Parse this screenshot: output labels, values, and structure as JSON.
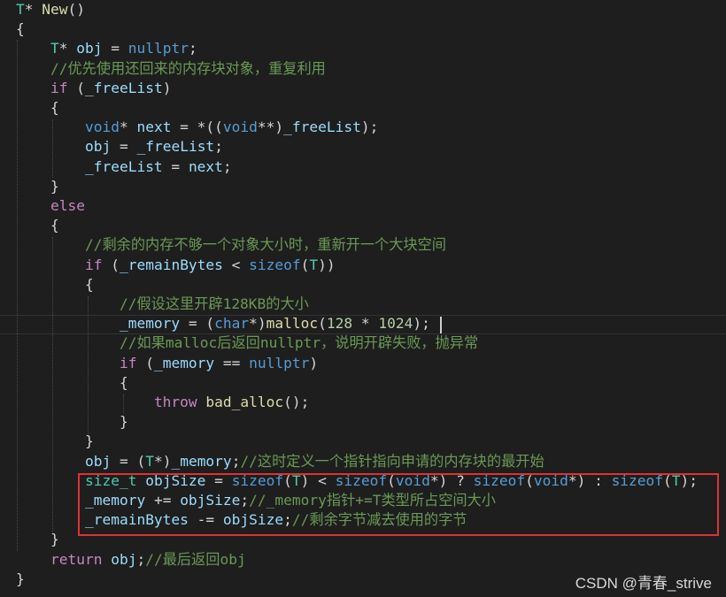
{
  "editor": {
    "language": "C++",
    "theme_colors": {
      "background": "#1e1e1e",
      "keyword": "#569cd6",
      "control": "#c586c0",
      "comment": "#6a9955",
      "function": "#dcdcaa",
      "type": "#4ec9b0",
      "variable": "#9cdcfe",
      "number": "#b5cea8",
      "text": "#d4d4d4",
      "highlight_box": "#e03131"
    },
    "lines": [
      [
        [
          "ty",
          "T"
        ],
        [
          "pl",
          "* "
        ],
        [
          "fn",
          "New"
        ],
        [
          "pl",
          "()"
        ]
      ],
      [
        [
          "pl",
          "{"
        ]
      ],
      [
        [
          "pl",
          "    "
        ],
        [
          "ty",
          "T"
        ],
        [
          "pl",
          "* "
        ],
        [
          "var",
          "obj"
        ],
        [
          "pl",
          " = "
        ],
        [
          "kw",
          "nullptr"
        ],
        [
          "pl",
          ";"
        ]
      ],
      [
        [
          "pl",
          "    "
        ],
        [
          "cm",
          "//优先使用还回来的内存块对象，重复利用"
        ]
      ],
      [
        [
          "pl",
          "    "
        ],
        [
          "ctl",
          "if"
        ],
        [
          "pl",
          " ("
        ],
        [
          "var",
          "_freeList"
        ],
        [
          "pl",
          ")"
        ]
      ],
      [
        [
          "pl",
          "    {"
        ]
      ],
      [
        [
          "pl",
          "        "
        ],
        [
          "kw",
          "void"
        ],
        [
          "pl",
          "* "
        ],
        [
          "var",
          "next"
        ],
        [
          "pl",
          " = *(("
        ],
        [
          "kw",
          "void"
        ],
        [
          "pl",
          "**)"
        ],
        [
          "var",
          "_freeList"
        ],
        [
          "pl",
          ");"
        ]
      ],
      [
        [
          "pl",
          "        "
        ],
        [
          "var",
          "obj"
        ],
        [
          "pl",
          " = "
        ],
        [
          "var",
          "_freeList"
        ],
        [
          "pl",
          ";"
        ]
      ],
      [
        [
          "pl",
          "        "
        ],
        [
          "var",
          "_freeList"
        ],
        [
          "pl",
          " = "
        ],
        [
          "var",
          "next"
        ],
        [
          "pl",
          ";"
        ]
      ],
      [
        [
          "pl",
          "    }"
        ]
      ],
      [
        [
          "pl",
          "    "
        ],
        [
          "ctl",
          "else"
        ]
      ],
      [
        [
          "pl",
          "    {"
        ]
      ],
      [
        [
          "pl",
          "        "
        ],
        [
          "cm",
          "//剩余的内存不够一个对象大小时，重新开一个大块空间"
        ]
      ],
      [
        [
          "pl",
          "        "
        ],
        [
          "ctl",
          "if"
        ],
        [
          "pl",
          " ("
        ],
        [
          "var",
          "_remainBytes"
        ],
        [
          "pl",
          " < "
        ],
        [
          "kw",
          "sizeof"
        ],
        [
          "pl",
          "("
        ],
        [
          "ty",
          "T"
        ],
        [
          "pl",
          "))"
        ]
      ],
      [
        [
          "pl",
          "        {"
        ]
      ],
      [
        [
          "pl",
          "            "
        ],
        [
          "cm",
          "//假设这里开辟128KB的大小"
        ]
      ],
      [
        [
          "pl",
          "            "
        ],
        [
          "var",
          "_memory"
        ],
        [
          "pl",
          " = ("
        ],
        [
          "kw",
          "char"
        ],
        [
          "pl",
          "*)"
        ],
        [
          "fn",
          "malloc"
        ],
        [
          "pl",
          "("
        ],
        [
          "num",
          "128"
        ],
        [
          "pl",
          " * "
        ],
        [
          "num",
          "1024"
        ],
        [
          "pl",
          ");"
        ]
      ],
      [
        [
          "pl",
          "            "
        ],
        [
          "cm",
          "//如果malloc后返回nullptr，说明开辟失败，抛异常"
        ]
      ],
      [
        [
          "pl",
          "            "
        ],
        [
          "ctl",
          "if"
        ],
        [
          "pl",
          " ("
        ],
        [
          "var",
          "_memory"
        ],
        [
          "pl",
          " == "
        ],
        [
          "kw",
          "nullptr"
        ],
        [
          "pl",
          ")"
        ]
      ],
      [
        [
          "pl",
          "            {"
        ]
      ],
      [
        [
          "pl",
          "                "
        ],
        [
          "ctl",
          "throw"
        ],
        [
          "pl",
          " "
        ],
        [
          "fn",
          "bad_alloc"
        ],
        [
          "pl",
          "();"
        ]
      ],
      [
        [
          "pl",
          "            }"
        ]
      ],
      [
        [
          "pl",
          "        }"
        ]
      ],
      [
        [
          "pl",
          "        "
        ],
        [
          "var",
          "obj"
        ],
        [
          "pl",
          " = ("
        ],
        [
          "ty",
          "T"
        ],
        [
          "pl",
          "*)"
        ],
        [
          "var",
          "_memory"
        ],
        [
          "pl",
          ";"
        ],
        [
          "cm",
          "//这时定义一个指针指向申请的内存块的最开始"
        ]
      ],
      [
        [
          "pl",
          "        "
        ],
        [
          "ty",
          "size_t"
        ],
        [
          "pl",
          " "
        ],
        [
          "var",
          "objSize"
        ],
        [
          "pl",
          " = "
        ],
        [
          "kw",
          "sizeof"
        ],
        [
          "pl",
          "("
        ],
        [
          "ty",
          "T"
        ],
        [
          "pl",
          ") < "
        ],
        [
          "kw",
          "sizeof"
        ],
        [
          "pl",
          "("
        ],
        [
          "kw",
          "void"
        ],
        [
          "pl",
          "*) ? "
        ],
        [
          "kw",
          "sizeof"
        ],
        [
          "pl",
          "("
        ],
        [
          "kw",
          "void"
        ],
        [
          "pl",
          "*) : "
        ],
        [
          "kw",
          "sizeof"
        ],
        [
          "pl",
          "("
        ],
        [
          "ty",
          "T"
        ],
        [
          "pl",
          ");"
        ]
      ],
      [
        [
          "pl",
          "        "
        ],
        [
          "var",
          "_memory"
        ],
        [
          "pl",
          " += "
        ],
        [
          "var",
          "objSize"
        ],
        [
          "pl",
          ";"
        ],
        [
          "cm",
          "//_memory指针+=T类型所占空间大小"
        ]
      ],
      [
        [
          "pl",
          "        "
        ],
        [
          "var",
          "_remainBytes"
        ],
        [
          "pl",
          " -= "
        ],
        [
          "var",
          "objSize"
        ],
        [
          "pl",
          ";"
        ],
        [
          "cm",
          "//剩余字节减去使用的字节"
        ]
      ],
      [
        [
          "pl",
          "    }"
        ]
      ],
      [
        [
          "pl",
          "    "
        ],
        [
          "ctl",
          "return"
        ],
        [
          "pl",
          " "
        ],
        [
          "var",
          "obj"
        ],
        [
          "pl",
          ";"
        ],
        [
          "cm",
          "//最后返回obj"
        ]
      ],
      [
        [
          "pl",
          "}"
        ]
      ]
    ]
  },
  "watermark": "CSDN @青春_strive"
}
